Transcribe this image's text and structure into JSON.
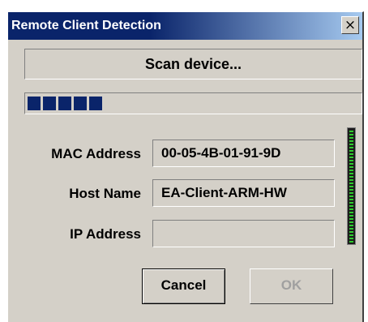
{
  "window": {
    "title": "Remote Client Detection",
    "close_glyph": "×",
    "close_icon": "close-icon"
  },
  "scan": {
    "label": "Scan device..."
  },
  "progress": {
    "segments_filled": 5,
    "fraction": 0.27
  },
  "fields": {
    "mac": {
      "label": "MAC Address",
      "value": "00-05-4B-01-91-9D"
    },
    "host": {
      "label": "Host Name",
      "value": "EA-Client-ARM-HW"
    },
    "ip": {
      "label": "IP Address",
      "value": ""
    }
  },
  "indicator": {
    "icon": "activity-led-icon",
    "color": "#2ecc2e"
  },
  "buttons": {
    "cancel": "Cancel",
    "ok": "OK"
  },
  "colors": {
    "title_bar": "#0a246a",
    "face": "#d4d0c8",
    "progress": "#0a246a",
    "disabled_text": "#a0a0a0"
  }
}
